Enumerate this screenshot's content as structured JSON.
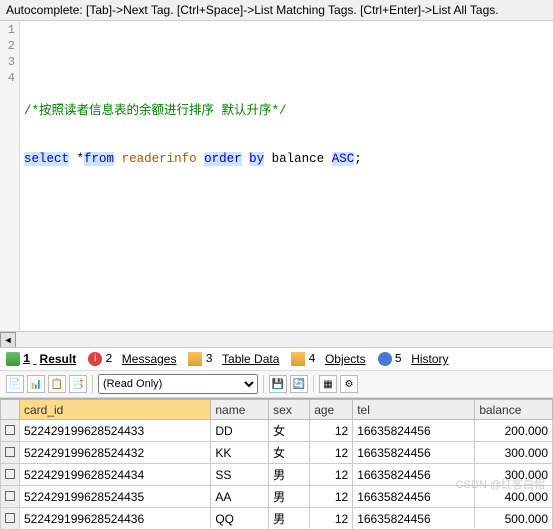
{
  "hint": "Autocomplete: [Tab]->Next Tag. [Ctrl+Space]->List Matching Tags. [Ctrl+Enter]->List All Tags.",
  "editor": {
    "lines": [
      "1",
      "2",
      "3",
      "4"
    ],
    "comment": "/*按照读者信息表的余额进行排序 默认升序*/",
    "sql": {
      "select": "select",
      "star": "*",
      "from": "from",
      "table": "readerinfo",
      "order": "order",
      "by": "by",
      "col": "balance",
      "dir": "ASC",
      "semi": ";"
    }
  },
  "tabs": {
    "result": {
      "num": "1",
      "label": "Result"
    },
    "messages": {
      "num": "2",
      "label": "Messages"
    },
    "tabledata": {
      "num": "3",
      "label": "Table Data"
    },
    "objects": {
      "num": "4",
      "label": "Objects"
    },
    "history": {
      "num": "5",
      "label": "History"
    }
  },
  "toolbar": {
    "mode": "(Read Only)"
  },
  "grid": {
    "headers": {
      "card_id": "card_id",
      "name": "name",
      "sex": "sex",
      "age": "age",
      "tel": "tel",
      "balance": "balance"
    },
    "rows": [
      {
        "card_id": "522429199628524433",
        "name": "DD",
        "sex": "女",
        "age": "12",
        "tel": "16635824456",
        "balance": "200.000"
      },
      {
        "card_id": "522429199628524432",
        "name": "KK",
        "sex": "女",
        "age": "12",
        "tel": "16635824456",
        "balance": "300.000"
      },
      {
        "card_id": "522429199628524434",
        "name": "SS",
        "sex": "男",
        "age": "12",
        "tel": "16635824456",
        "balance": "300.000"
      },
      {
        "card_id": "522429199628524435",
        "name": "AA",
        "sex": "男",
        "age": "12",
        "tel": "16635824456",
        "balance": "400.000"
      },
      {
        "card_id": "522429199628524436",
        "name": "QQ",
        "sex": "男",
        "age": "12",
        "tel": "16635824456",
        "balance": "500.000"
      }
    ]
  },
  "watermark": "CSDN @红客白帽"
}
